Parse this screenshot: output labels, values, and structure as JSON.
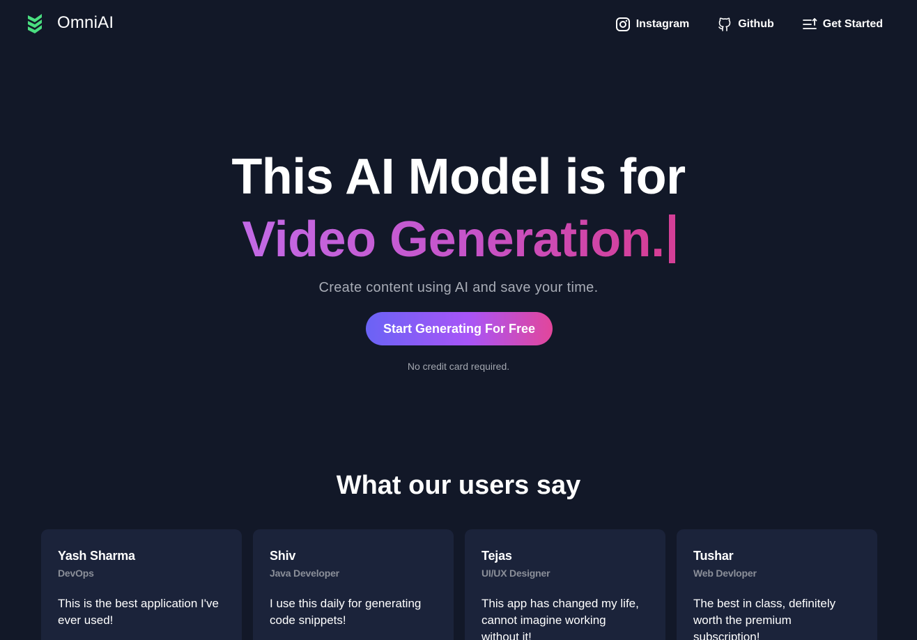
{
  "header": {
    "brand_name": "OmniAI",
    "brand_logo": "layered-chevrons-logo",
    "nav": [
      {
        "label": "Instagram",
        "icon": "instagram-icon"
      },
      {
        "label": "Github",
        "icon": "github-icon"
      },
      {
        "label": "Get Started",
        "icon": "list-filter-icon"
      }
    ]
  },
  "hero": {
    "headline": "This AI Model is for",
    "rotating_text": "Video Generation.",
    "subtitle": "Create content using AI and save your time.",
    "cta_label": "Start Generating For Free",
    "cta_note": "No credit card required."
  },
  "testimonials": {
    "title": "What our users say",
    "items": [
      {
        "name": "Yash Sharma",
        "role": "DevOps",
        "quote": "This is the best application I've ever used!"
      },
      {
        "name": "Shiv",
        "role": "Java Developer",
        "quote": "I use this daily for generating code snippets!"
      },
      {
        "name": "Tejas",
        "role": "UI/UX Designer",
        "quote": "This app has changed my life, cannot imagine working without it!"
      },
      {
        "name": "Tushar",
        "role": "Web Devloper",
        "quote": "The best in class, definitely worth the premium subscription!"
      }
    ]
  },
  "colors": {
    "background": "#121828",
    "card": "#1b233a",
    "brand_green": "#4ade80",
    "gradient_start": "#6a63f5",
    "gradient_mid": "#a855f7",
    "gradient_end": "#e2469b"
  }
}
